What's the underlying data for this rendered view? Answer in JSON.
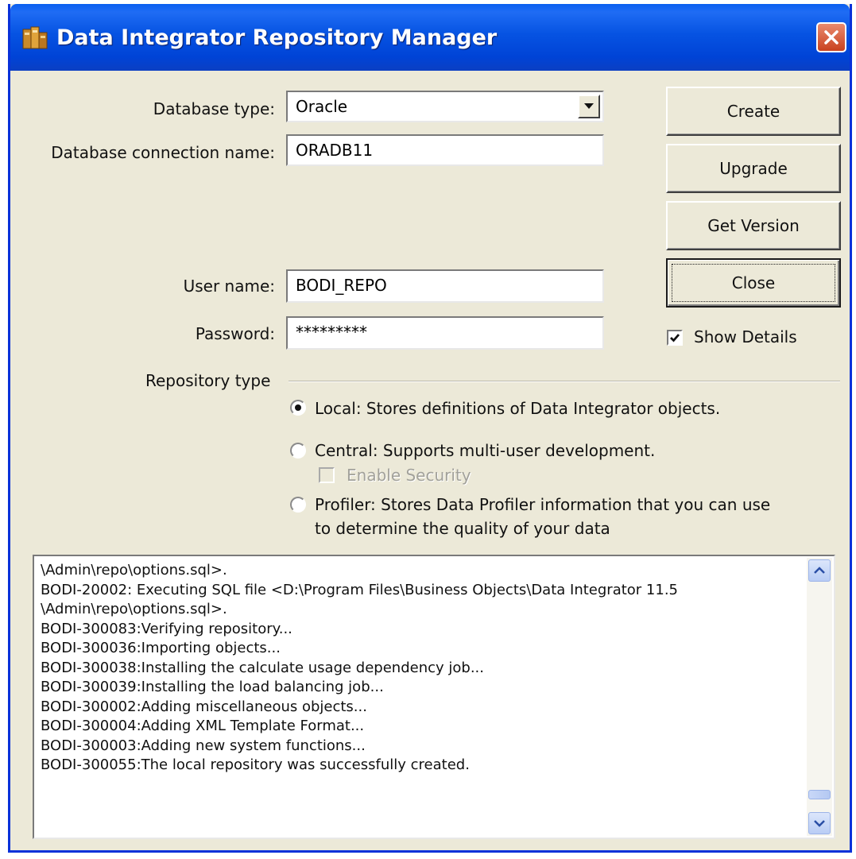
{
  "window": {
    "title": "Data Integrator Repository Manager",
    "icons": {
      "app": "data-integrator-app-icon",
      "close": "close-icon"
    }
  },
  "form": {
    "database_type": {
      "label": "Database type:",
      "value": "Oracle"
    },
    "connection_name": {
      "label": "Database connection name:",
      "value": "ORADB11"
    },
    "user_name": {
      "label": "User name:",
      "value": "BODI_REPO"
    },
    "password": {
      "label": "Password:",
      "value": "*********"
    }
  },
  "buttons": {
    "create": "Create",
    "upgrade": "Upgrade",
    "get_version": "Get Version",
    "close": "Close"
  },
  "show_details": {
    "label": "Show Details",
    "checked": true
  },
  "repository_type": {
    "label": "Repository type",
    "selected": "local",
    "local": "Local: Stores definitions of Data Integrator objects.",
    "central": "Central: Supports multi-user development.",
    "enable_security": {
      "label": "Enable Security",
      "checked": false,
      "enabled": false
    },
    "profiler_line1": "Profiler: Stores Data Profiler information that you can use",
    "profiler_line2": "to determine the quality of your data"
  },
  "log": [
    "\\Admin\\repo\\options.sql>.",
    "BODI-20002: Executing SQL file <D:\\Program Files\\Business Objects\\Data Integrator 11.5",
    "\\Admin\\repo\\options.sql>.",
    "BODI-300083:Verifying repository...",
    "BODI-300036:Importing objects...",
    "BODI-300038:Installing the calculate usage dependency job...",
    "BODI-300039:Installing the load balancing job...",
    "BODI-300002:Adding miscellaneous objects...",
    "BODI-300004:Adding XML Template Format...",
    "BODI-300003:Adding new system functions...",
    "BODI-300055:The local repository was successfully created."
  ],
  "log_scroll_position": 0.95
}
